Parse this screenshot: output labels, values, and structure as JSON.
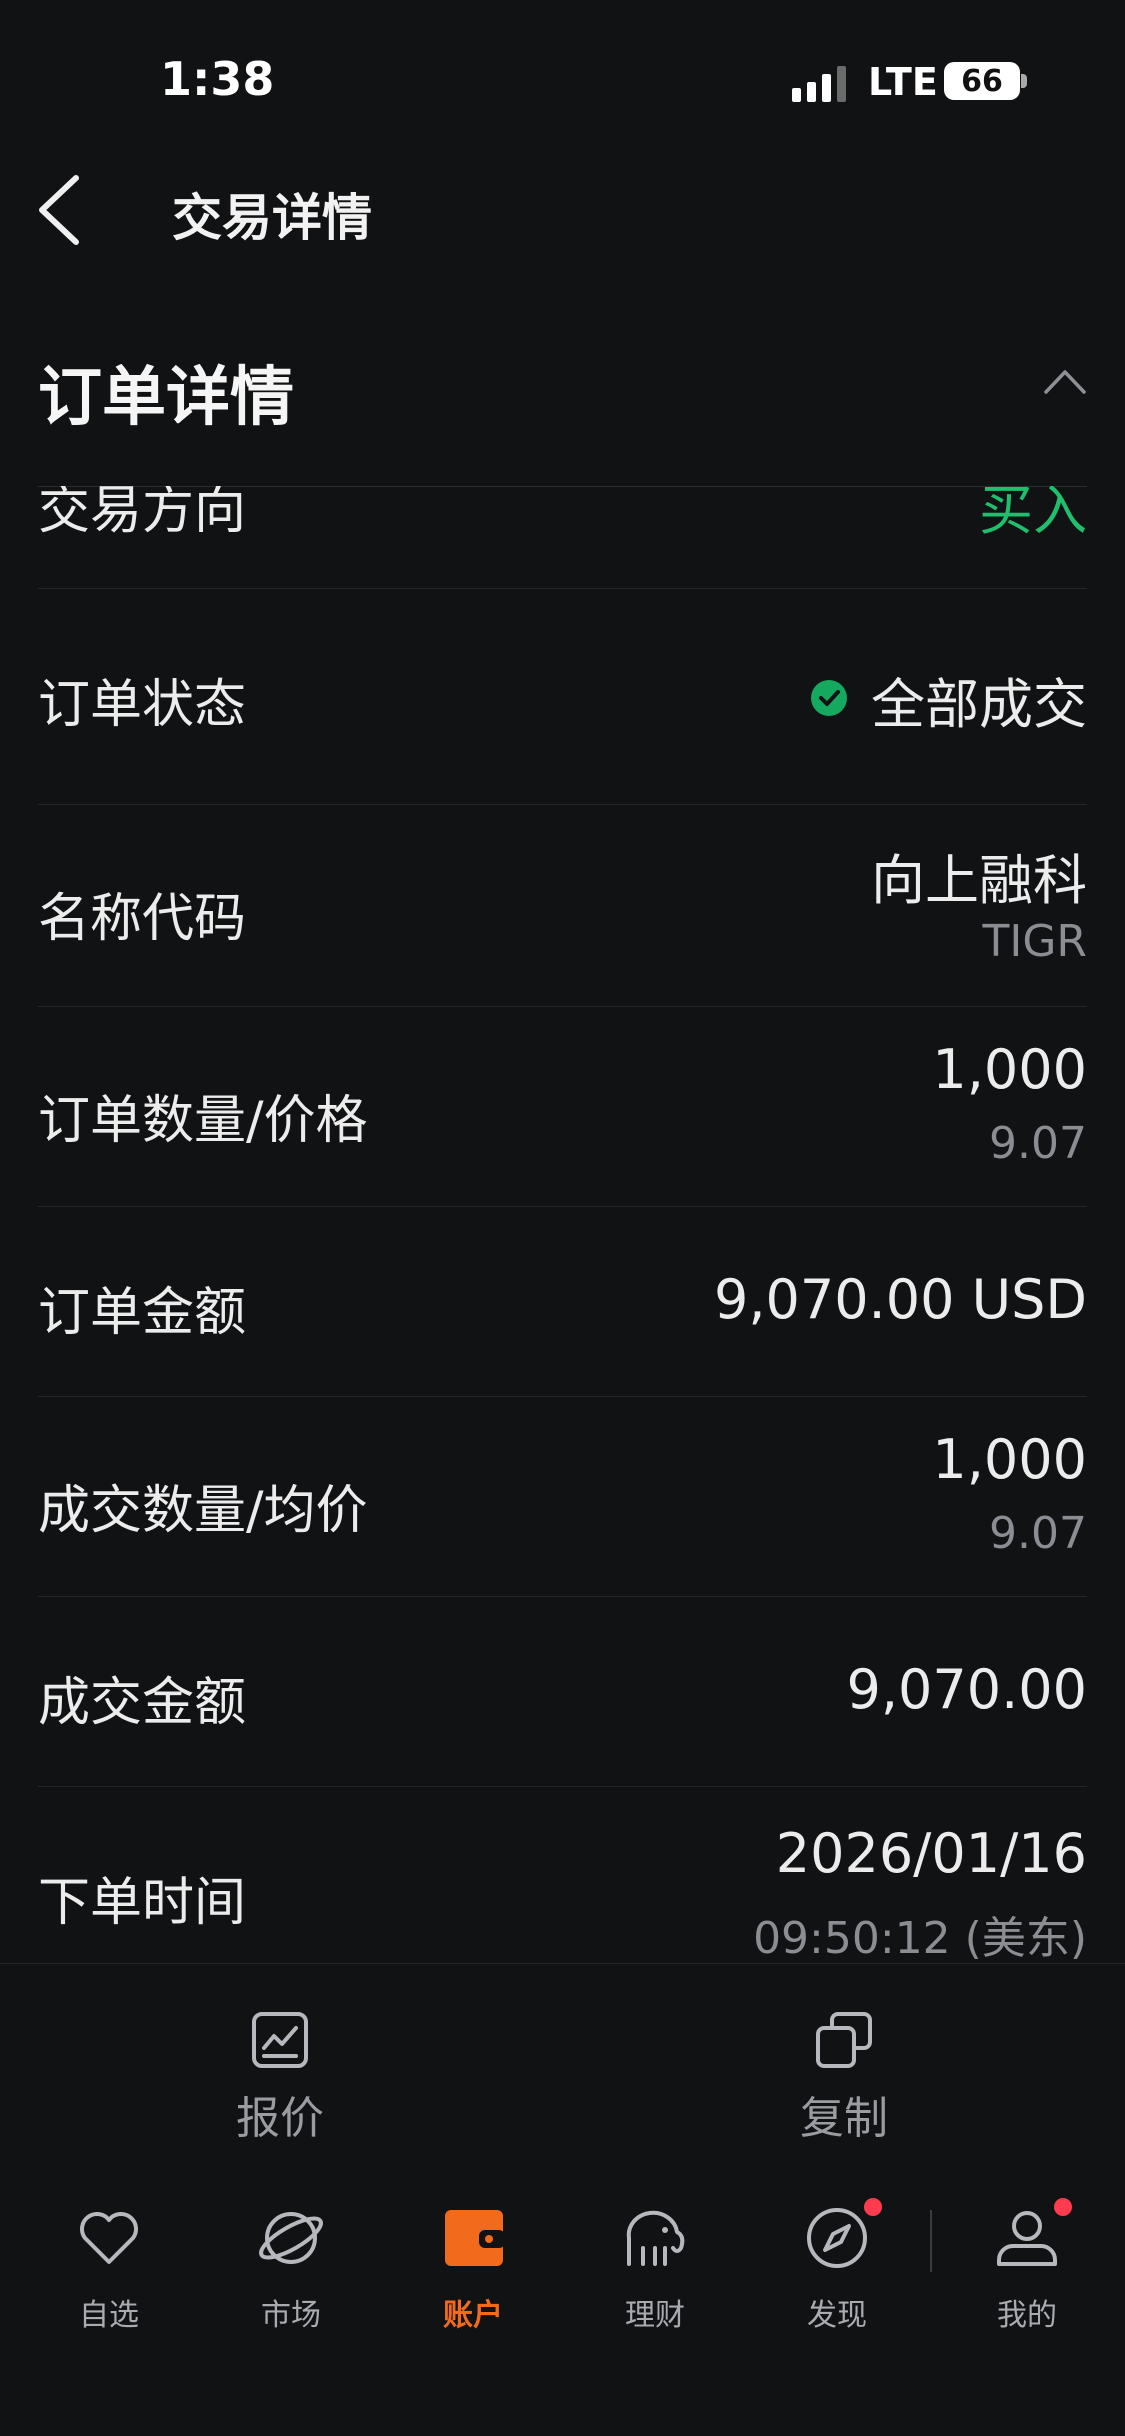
{
  "status_bar": {
    "time": "1:38",
    "network": "LTE",
    "battery": "66"
  },
  "header": {
    "title": "交易详情",
    "back_icon": "chevron-left-icon"
  },
  "section": {
    "title": "订单详情",
    "collapse_icon": "chevron-up-icon"
  },
  "rows": [
    {
      "label": "交易方向",
      "value": "买入"
    },
    {
      "label": "订单状态",
      "value": "全部成交"
    },
    {
      "label": "名称代码",
      "value": "向上融科",
      "sub": "TIGR"
    },
    {
      "label": "订单数量/价格",
      "value": "1,000",
      "sub": "9.07"
    },
    {
      "label": "订单金额",
      "value": "9,070.00 USD"
    },
    {
      "label": "成交数量/均价",
      "value": "1,000",
      "sub": "9.07"
    },
    {
      "label": "成交金额",
      "value": "9,070.00"
    },
    {
      "label": "下单时间",
      "value": "2026/01/16",
      "sub": "09:50:12 (美东)"
    }
  ],
  "actions": [
    {
      "label": "报价",
      "icon": "chart-quote-icon"
    },
    {
      "label": "复制",
      "icon": "copy-icon"
    }
  ],
  "tabs": [
    {
      "label": "自选",
      "icon": "heart-icon"
    },
    {
      "label": "市场",
      "icon": "planet-icon"
    },
    {
      "label": "账户",
      "icon": "wallet-icon",
      "active": true
    },
    {
      "label": "理财",
      "icon": "elephant-icon"
    },
    {
      "label": "发现",
      "icon": "compass-icon",
      "badge": true
    },
    {
      "label": "我的",
      "icon": "user-icon",
      "badge": true
    }
  ],
  "colors": {
    "accent": "#f26b1d",
    "buy": "#1fbf6e",
    "badge": "#ff3b4e",
    "background": "#111214"
  }
}
